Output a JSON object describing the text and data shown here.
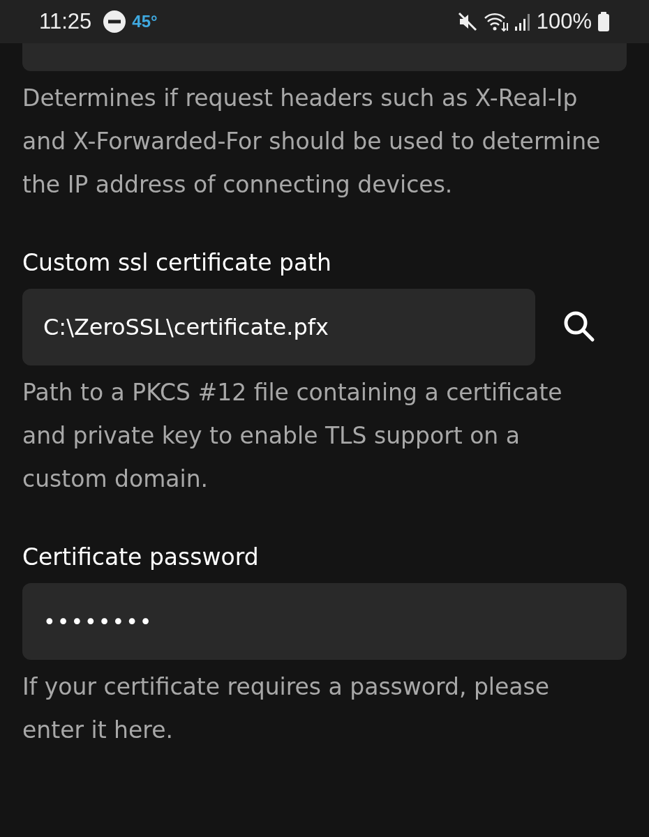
{
  "status_bar": {
    "time": "11:25",
    "temperature": "45°",
    "battery": "100%"
  },
  "top_setting": {
    "description": "Determines if request headers such as X-Real-Ip and X-Forwarded-For should be used to determine the IP address of connecting devices."
  },
  "settings": [
    {
      "kind": "path",
      "label": "Custom ssl certificate path",
      "value": "C:\\ZeroSSL\\certificate.pfx",
      "description": "Path to a PKCS #12 file containing a certificate and private key to enable TLS support on a custom domain."
    },
    {
      "kind": "password",
      "label": "Certificate password",
      "value": "••••••••",
      "description": "If your certificate requires a password, please enter it here."
    }
  ]
}
